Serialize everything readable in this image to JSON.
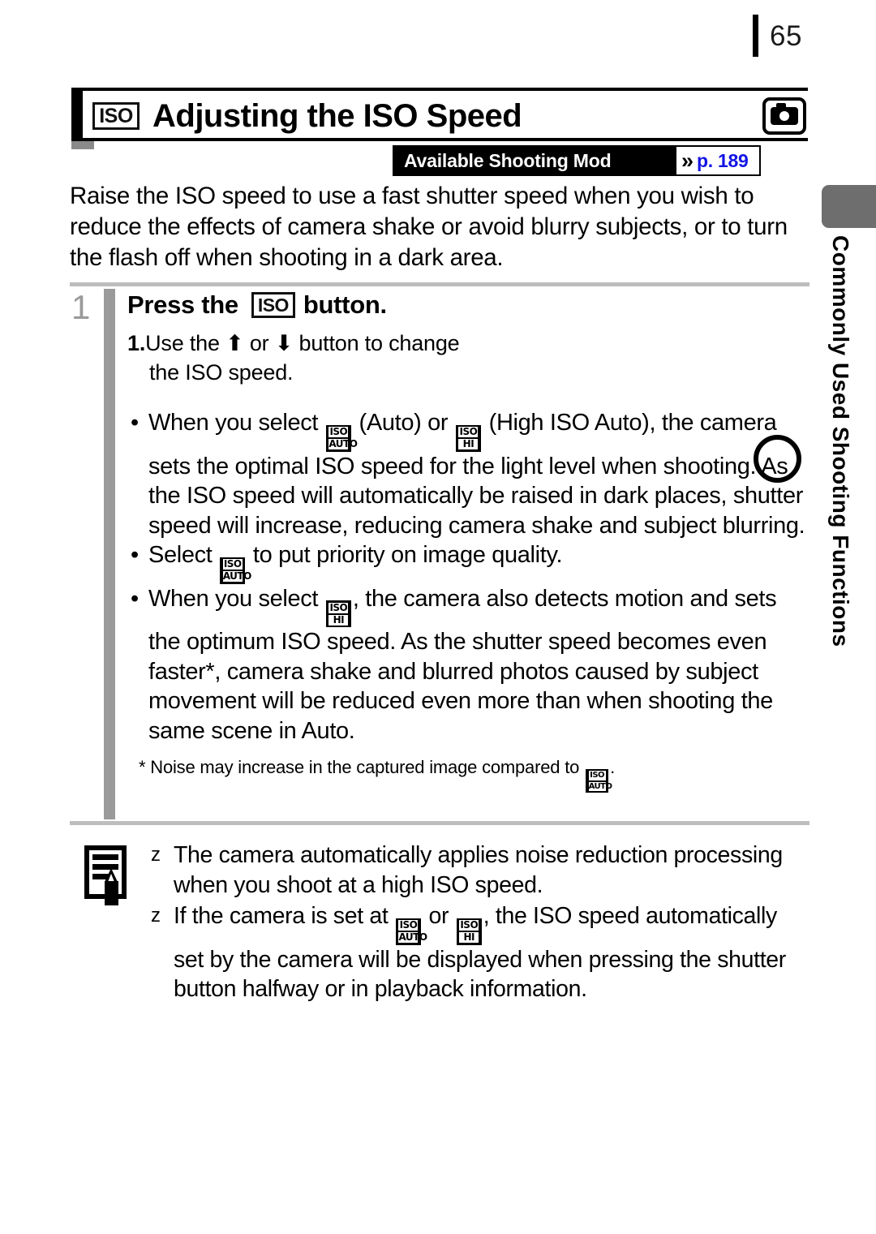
{
  "page": {
    "number": "65"
  },
  "header": {
    "iso_icon_label": "ISO",
    "title": "Adjusting the ISO Speed",
    "camera_icon": "camera-icon"
  },
  "modes_banner": {
    "label": "Available Shooting Mod",
    "chevron": "»",
    "page_ref": "p. 189",
    "ref_color": "#1414e6"
  },
  "intro": {
    "text": "Raise the ISO speed to use a fast shutter speed when you wish to reduce the effects of camera shake or avoid blurry subjects, or to turn the flash off when shooting in a dark area."
  },
  "step": {
    "number": "1",
    "heading_before": "Press the",
    "heading_icon": "ISO",
    "heading_after": "button.",
    "substep_number": "1.",
    "substep_line1_before": "Use the",
    "substep_arrow_up": "⬆",
    "substep_or": "or",
    "substep_arrow_down": "⬇",
    "substep_line1_after": "button to change",
    "substep_line2": "the ISO speed.",
    "bullets": [
      {
        "id": "bullet-auto-highiso",
        "segments": [
          "When you select ",
          "[ISO AUTO]",
          " (Auto) or ",
          "[ISO HI]",
          " (High ISO Auto), the camera sets the optimal ISO speed for the light level when shooting. As the ISO speed will automatically be raised in dark places, shutter speed will increase, reducing camera shake and subject blurring."
        ]
      },
      {
        "id": "bullet-image-quality",
        "segments": [
          "Select ",
          "[ISO AUTO]",
          " to put priority on image quality."
        ]
      },
      {
        "id": "bullet-motion-detect",
        "segments": [
          "When you select ",
          "[ISO HI]",
          ", the camera also detects motion and sets the optimum ISO speed. As the shutter speed becomes even faster*, camera shake and blurred photos caused by subject movement will be reduced even more than when shooting the same scene in Auto."
        ]
      }
    ],
    "footnote_before": "* Noise may increase in the captured image compared to",
    "footnote_icon": "[ISO AUTO]",
    "footnote_after": "."
  },
  "note": {
    "icon": "memo-pencil-icon",
    "marker": "z",
    "items": [
      {
        "id": "note-noise-reduction",
        "text": "The camera automatically applies noise reduction processing when you shoot at a high ISO speed."
      },
      {
        "id": "note-display-iso",
        "before": "If the camera is set at ",
        "icon_a": "[ISO AUTO]",
        "middle": " or ",
        "icon_b": "[ISO HI]",
        "after": ", the ISO speed automatically set by the camera will be displayed when pressing the shutter button halfway or in playback information."
      }
    ]
  },
  "side_tab": {
    "label": "Commonly Used Shooting Functions",
    "tab_color": "#6e6e6e"
  },
  "icons": {
    "iso_auto_top": "ISO",
    "iso_auto_bottom": "AUTO",
    "iso_hi_top": "ISO",
    "iso_hi_bottom": "HI"
  }
}
